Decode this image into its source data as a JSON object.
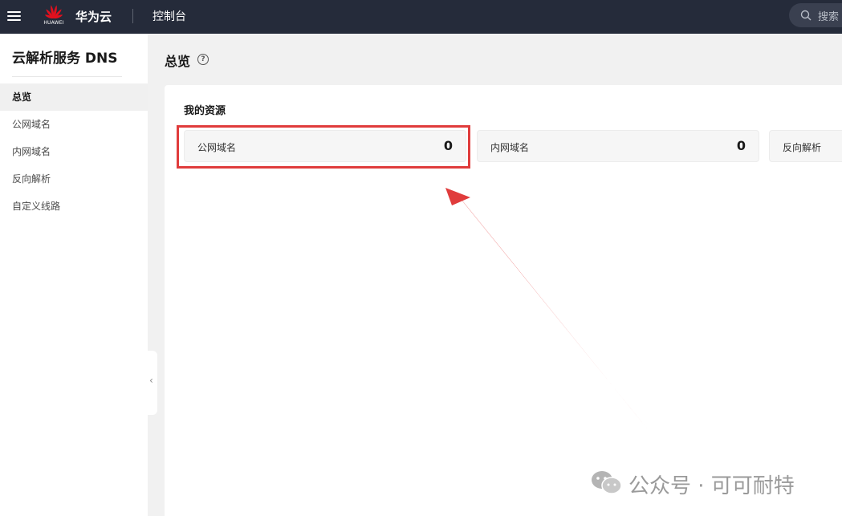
{
  "topbar": {
    "logo_text": "HUAWEI",
    "brand": "华为云",
    "console": "控制台",
    "search_placeholder": "搜索"
  },
  "sidebar": {
    "service_title": "云解析服务 DNS",
    "items": [
      {
        "label": "总览"
      },
      {
        "label": "公网域名"
      },
      {
        "label": "内网域名"
      },
      {
        "label": "反向解析"
      },
      {
        "label": "自定义线路"
      }
    ],
    "collapse_glyph": "‹"
  },
  "main": {
    "title": "总览",
    "help_glyph": "?",
    "section_title": "我的资源",
    "resources": [
      {
        "label": "公网域名",
        "count": "0"
      },
      {
        "label": "内网域名",
        "count": "0"
      },
      {
        "label": "反向解析",
        "count": ""
      }
    ]
  },
  "annotation": {
    "color": "#e03c3c"
  },
  "watermark": {
    "text": "公众号 · 可可耐特"
  },
  "colors": {
    "topbar_bg": "#252b3a",
    "accent_red": "#e03c3c"
  }
}
